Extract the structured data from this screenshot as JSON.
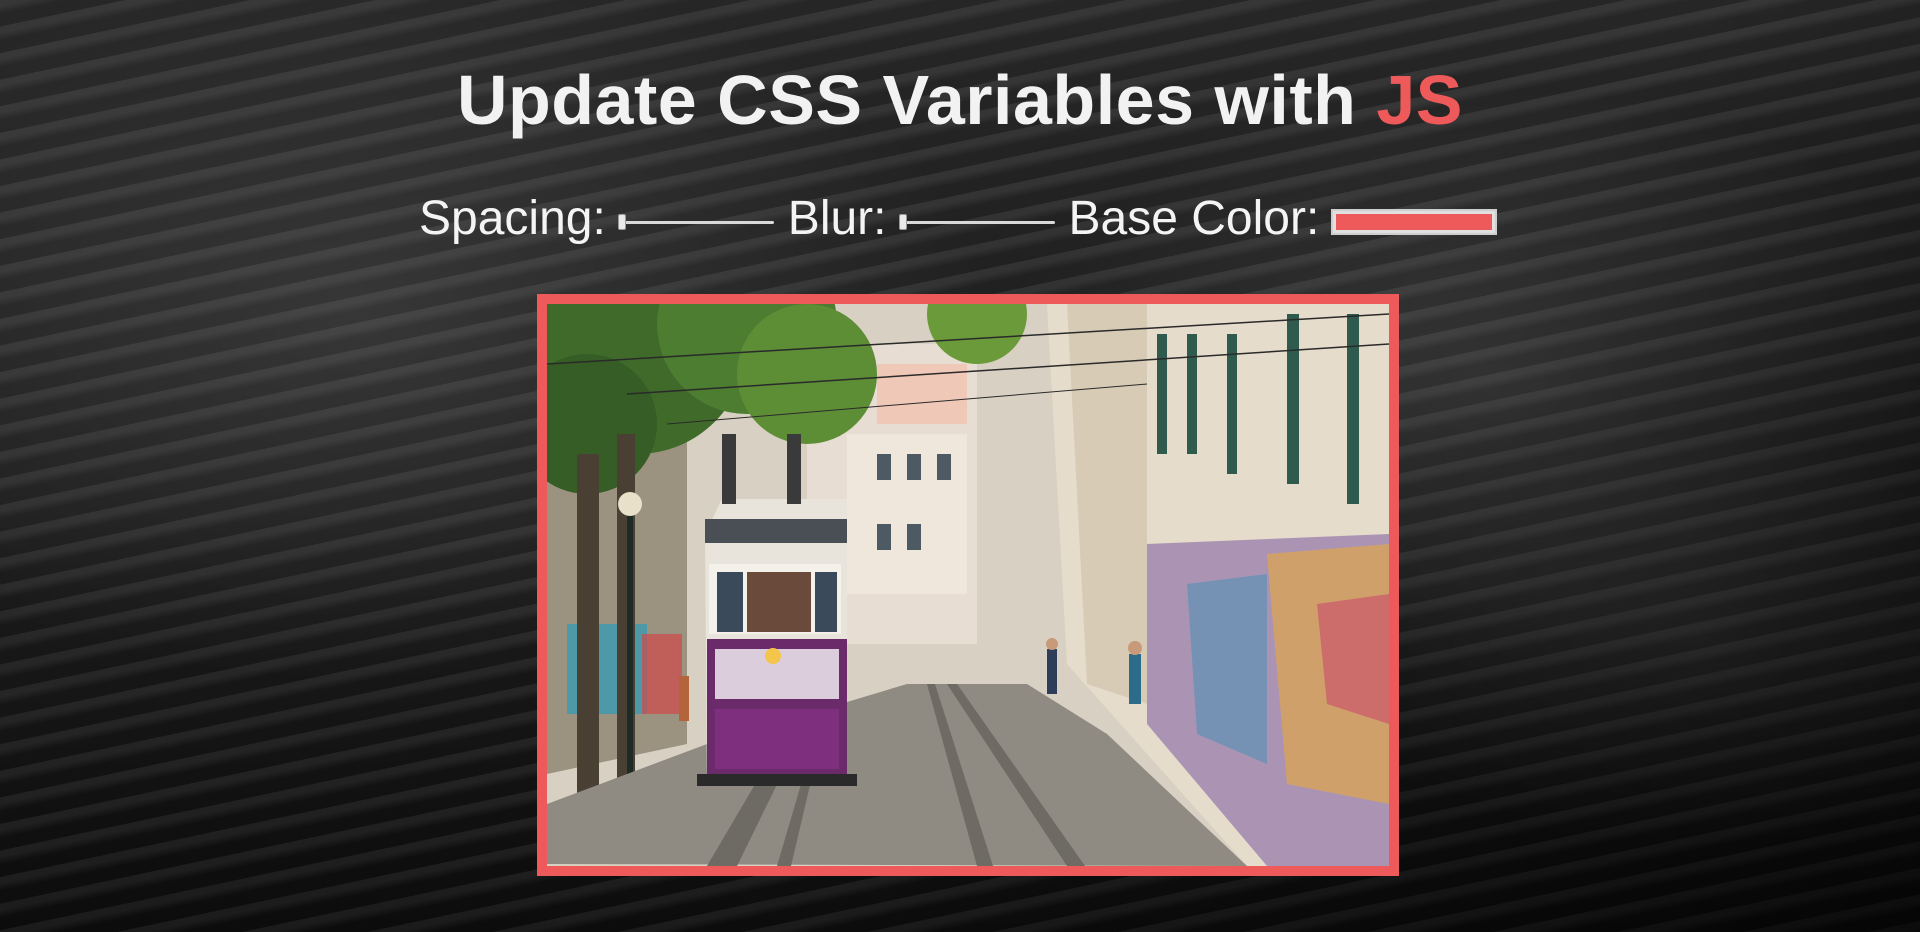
{
  "page": {
    "title_main": "Update CSS Variables with ",
    "title_highlight": "JS"
  },
  "controls": {
    "spacing": {
      "label": "Spacing:",
      "value": 0.0
    },
    "blur": {
      "label": "Blur:",
      "value": 0.0
    },
    "base_color": {
      "label": "Base Color:",
      "value": "#ee5a5a"
    }
  },
  "image": {
    "subject": "tram-on-graffiti-street-photo",
    "border_color": "#ee5a5a"
  },
  "colors": {
    "accent": "#ee5a5a",
    "text": "#f2f2f2",
    "background": "#1b1b1b"
  }
}
